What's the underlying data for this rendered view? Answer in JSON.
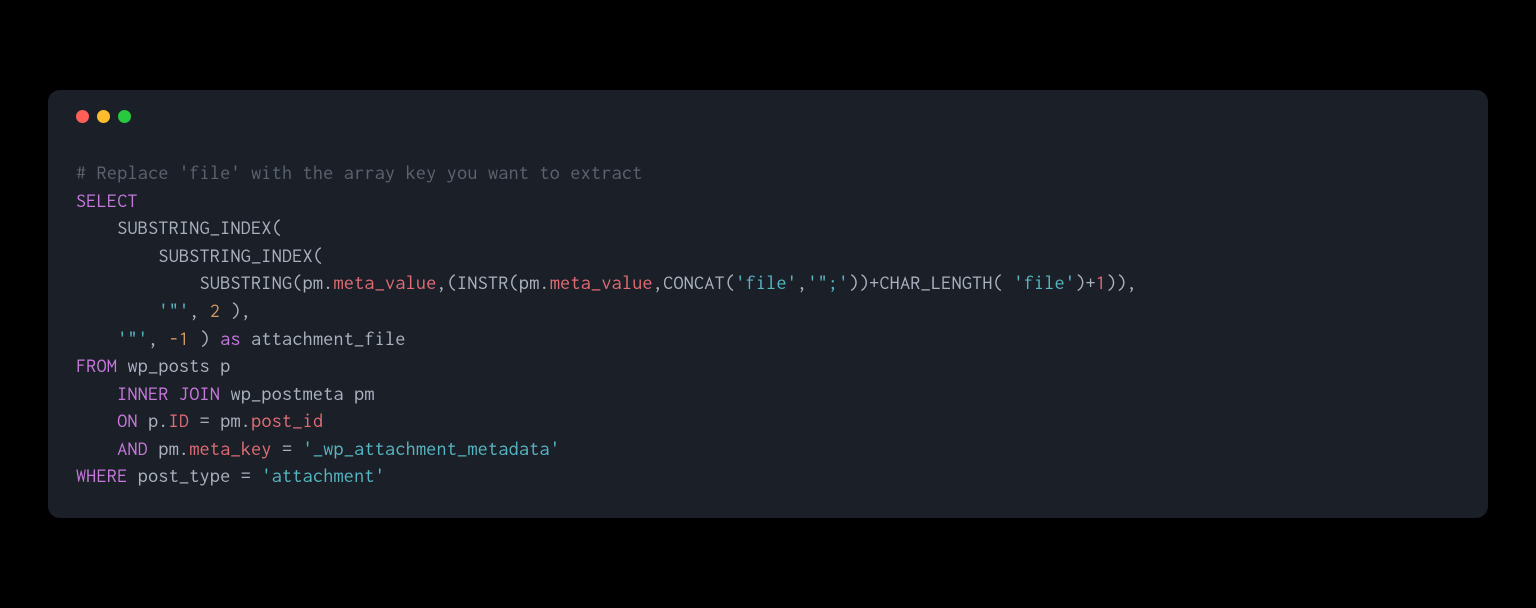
{
  "titlebar": {
    "close": "close",
    "minimize": "minimize",
    "maximize": "maximize"
  },
  "code": {
    "l1_comment": "# Replace 'file' with the array key you want to extract",
    "l2_select": "SELECT",
    "l3_indent": "    ",
    "l3_fn": "SUBSTRING_INDEX(",
    "l4_indent": "        ",
    "l4_fn": "SUBSTRING_INDEX(",
    "l5_indent": "            ",
    "l5_fn1": "SUBSTRING(pm",
    "l5_dot1": ".",
    "l5_prop1": "meta_value",
    "l5_mid1": ",(INSTR(pm",
    "l5_dot2": ".",
    "l5_prop2": "meta_value",
    "l5_mid2": ",CONCAT(",
    "l5_str1": "'file'",
    "l5_comma1": ",",
    "l5_str2": "'\";'",
    "l5_mid3": "))+CHAR_LENGTH( ",
    "l5_str3": "'file'",
    "l5_plus": ")+",
    "l5_one": "1",
    "l5_end": ")),",
    "l6_indent": "        ",
    "l6_str": "'\"'",
    "l6_comma": ", ",
    "l6_num": "2",
    "l6_end": " ),",
    "l7_indent": "    ",
    "l7_str": "'\"'",
    "l7_comma": ", ",
    "l7_neg": "-1",
    "l7_end": " ) ",
    "l7_as": "as",
    "l7_alias": " attachment_file",
    "l8_from": "FROM",
    "l8_rest": " wp_posts p",
    "l9_indent": "    ",
    "l9_inner": "INNER",
    "l9_sp1": " ",
    "l9_join": "JOIN",
    "l9_rest": " wp_postmeta pm",
    "l10_indent": "    ",
    "l10_on": "ON",
    "l10_sp": " p",
    "l10_dot": ".",
    "l10_id": "ID",
    "l10_eq": " = pm",
    "l10_dot2": ".",
    "l10_postid": "post_id",
    "l11_indent": "    ",
    "l11_and": "AND",
    "l11_sp": " pm",
    "l11_dot": ".",
    "l11_metakey": "meta_key",
    "l11_eq": " = ",
    "l11_str": "'_wp_attachment_metadata'",
    "l12_where": "WHERE",
    "l12_sp": " post_type = ",
    "l12_str": "'attachment'"
  }
}
